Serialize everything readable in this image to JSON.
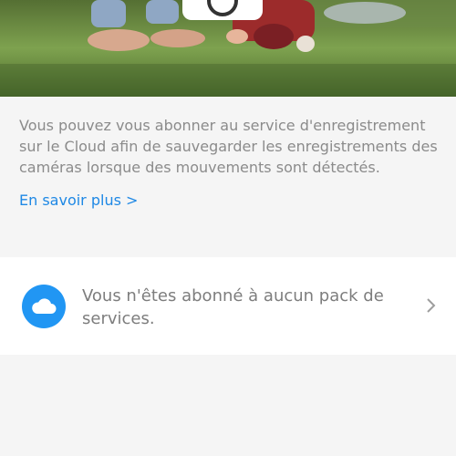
{
  "hero": {
    "icon": "camera-icon"
  },
  "info": {
    "description": "Vous pouvez vous abonner au service d'enregistrement sur le Cloud afin de sauvegarder les enregistrements des caméras lorsque des mouvements sont détectés.",
    "learn_more_label": "En savoir plus >"
  },
  "service": {
    "icon": "cloud-icon",
    "status_text": "Vous n'êtes abonné à aucun pack de services.",
    "chevron_icon": "chevron-right-icon"
  },
  "colors": {
    "accent": "#2196f3",
    "link": "#1e88e5",
    "background": "#f5f5f5",
    "card": "#ffffff"
  }
}
